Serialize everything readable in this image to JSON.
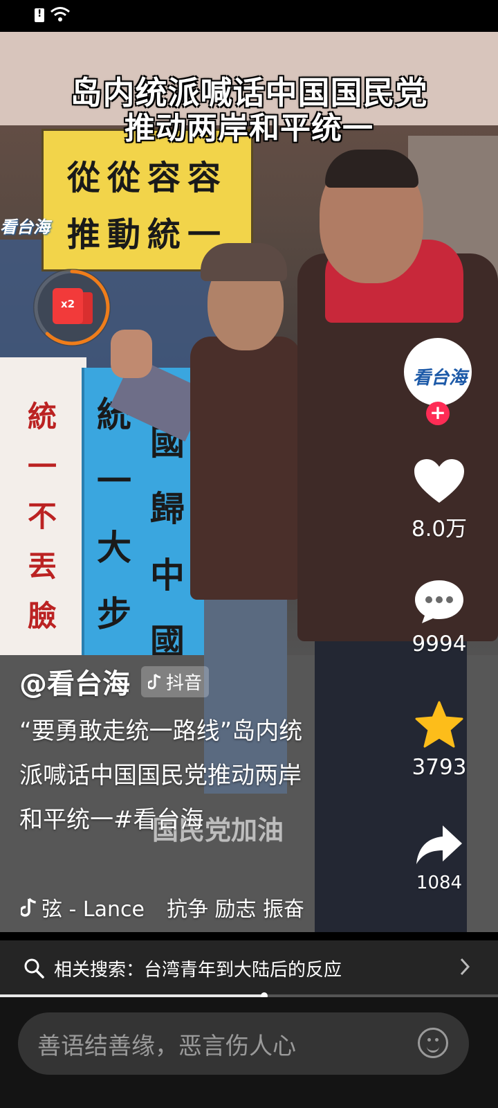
{
  "video": {
    "caption_line1": "岛内统派喊话中国国民党",
    "caption_line2": "推动两岸和平统一",
    "subtitle": "国民党加油",
    "watermark": "看台海",
    "signs": {
      "yellow_line1": "從從容容",
      "yellow_line2": "推動統一",
      "blue_col1": "統一大步走",
      "blue_col2": "國歸中國",
      "white_col": "統一不丟臉"
    }
  },
  "red_packet": {
    "multiplier": "x2",
    "progress": 0.62,
    "accent": "#f07d1a"
  },
  "rail": {
    "avatar_text": "看台海",
    "follow_symbol": "+",
    "likes": "8.0万",
    "comments": "9994",
    "favorites": "3793",
    "shares": "1084"
  },
  "author": {
    "handle": "@看台海",
    "platform": "抖音"
  },
  "description": "“要勇敢走统一路线”岛内统派喊话中国国民党推动两岸和平统一#看台海",
  "music": {
    "track": "弦 - Lance",
    "tags": "抗争 励志 振奋"
  },
  "related_search": {
    "text": "相关搜索：台湾青年到大陆后的反应"
  },
  "playback": {
    "progress": 0.53
  },
  "comment_box": {
    "placeholder": "善语结善缘，恶言伤人心"
  },
  "colors": {
    "follow": "#fe2c55",
    "favorite": "#fdbd1a"
  }
}
